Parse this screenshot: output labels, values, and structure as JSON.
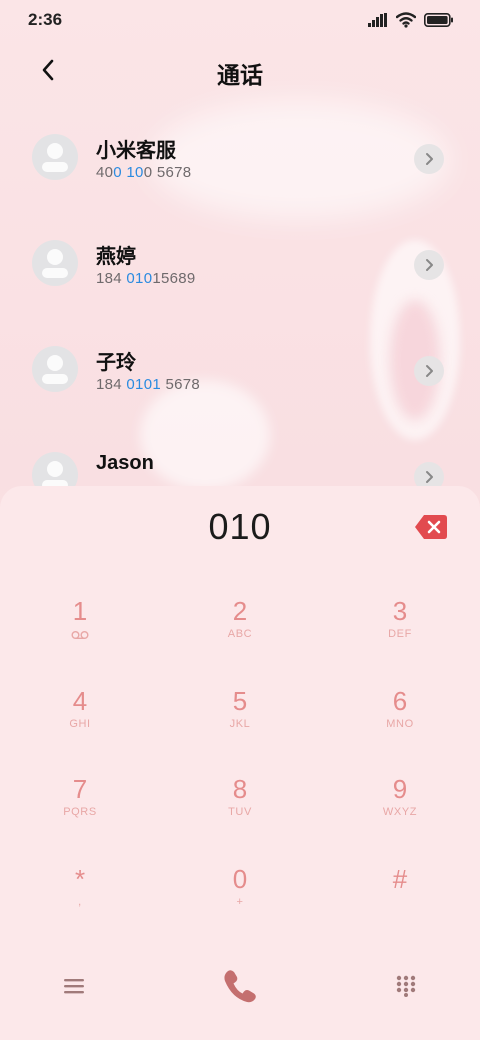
{
  "status": {
    "time": "2:36"
  },
  "header": {
    "title": "通话"
  },
  "contacts": [
    {
      "name": "小米客服",
      "number_parts": [
        "40",
        "0 10",
        "0 5678"
      ]
    },
    {
      "name": "燕婷",
      "number_parts": [
        "184 ",
        "010",
        "15689"
      ]
    },
    {
      "name": "子玲",
      "number_parts": [
        "184 ",
        "0101",
        " 5678"
      ]
    },
    {
      "name": "Jason",
      "number_parts": [
        "",
        "",
        ""
      ]
    }
  ],
  "dialer": {
    "input": "010",
    "keys": [
      {
        "digit": "1",
        "letters": ""
      },
      {
        "digit": "2",
        "letters": "ABC"
      },
      {
        "digit": "3",
        "letters": "DEF"
      },
      {
        "digit": "4",
        "letters": "GHI"
      },
      {
        "digit": "5",
        "letters": "JKL"
      },
      {
        "digit": "6",
        "letters": "MNO"
      },
      {
        "digit": "7",
        "letters": "PQRS"
      },
      {
        "digit": "8",
        "letters": "TUV"
      },
      {
        "digit": "9",
        "letters": "WXYZ"
      },
      {
        "digit": "*",
        "letters": ","
      },
      {
        "digit": "0",
        "letters": "+"
      },
      {
        "digit": "#",
        "letters": ""
      }
    ]
  },
  "icons": {
    "back": "back-arrow-icon",
    "chevron": "chevron-right-icon",
    "delete": "backspace-icon",
    "voicemail": "voicemail-icon",
    "menu": "menu-icon",
    "call": "phone-icon",
    "keypad": "keypad-icon"
  },
  "colors": {
    "accent": "#e58c8c",
    "highlight": "#2b8be0",
    "delete": "#e24a4f",
    "call": "#c46f6f"
  }
}
